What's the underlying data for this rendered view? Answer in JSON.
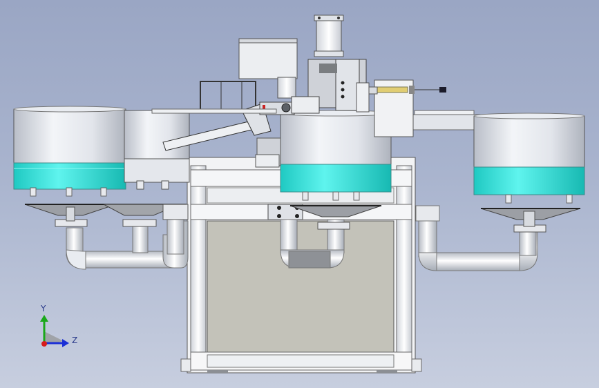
{
  "view": {
    "background_top": "#9aa6c4",
    "background_bottom": "#c7cedf"
  },
  "triad": {
    "y_label": "Y",
    "z_label": "Z",
    "y_color": "#1aa81a",
    "z_color": "#1b2fd6",
    "x_color": "#d61b1b"
  },
  "colors": {
    "bowl_body": "#dfe3ea",
    "bowl_band": "#34e3dc",
    "frame": "#f4f5f7",
    "panel": "#c3c2b9",
    "pipe": "#eef0f3",
    "dark_metal": "#6d6f6f"
  }
}
